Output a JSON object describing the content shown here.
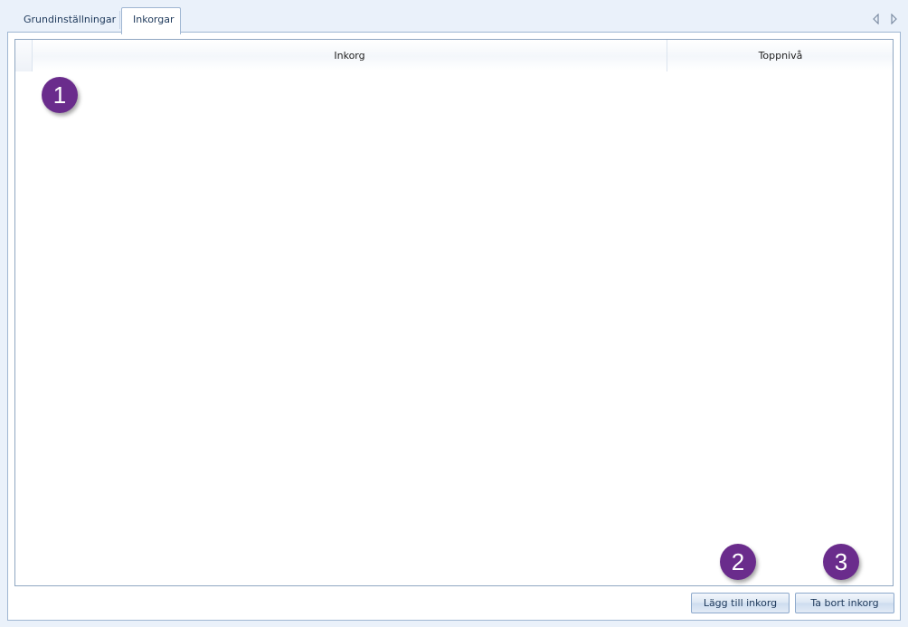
{
  "tabs": [
    {
      "label": "Grundinställningar",
      "active": false
    },
    {
      "label": "Inkorgar",
      "active": true
    }
  ],
  "grid": {
    "columns": [
      "Inkorg",
      "Toppnivå"
    ],
    "rows": []
  },
  "buttons": {
    "add_label": "Lägg till inkorg",
    "remove_label": "Ta bort inkorg"
  },
  "callouts": [
    "1",
    "2",
    "3"
  ],
  "colors": {
    "background": "#eaf1fa",
    "border": "#9fb6d2",
    "callout": "#6a2c8c",
    "text": "#1e395b"
  }
}
